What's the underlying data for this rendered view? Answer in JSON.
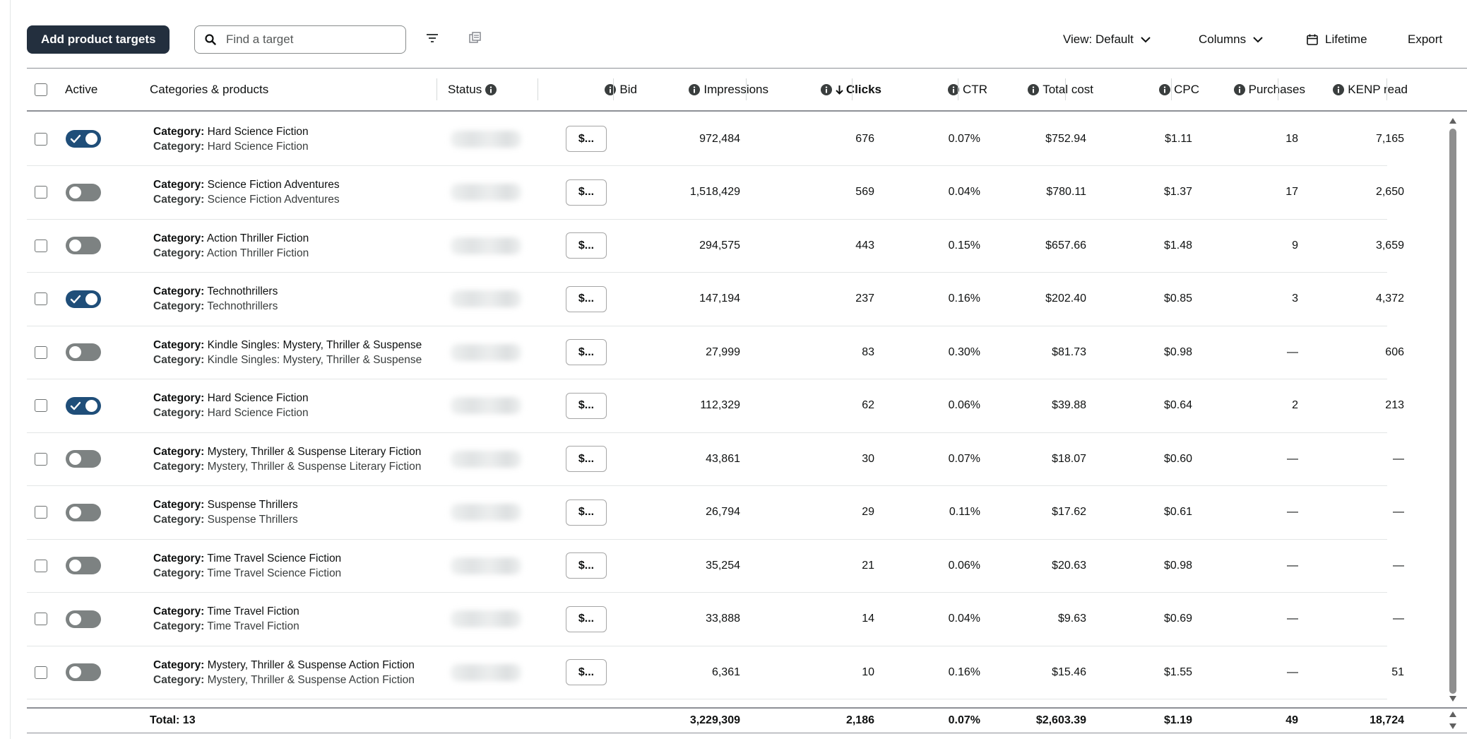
{
  "toolbar": {
    "add_button_label": "Add product targets",
    "search_placeholder": "Find a target",
    "view_label": "View: Default",
    "columns_label": "Columns",
    "date_range_label": "Lifetime",
    "export_label": "Export"
  },
  "table": {
    "headers": {
      "active": "Active",
      "categories": "Categories & products",
      "status": "Status",
      "bid": "Bid",
      "impressions": "Impressions",
      "clicks": "Clicks",
      "ctr": "CTR",
      "total_cost": "Total cost",
      "cpc": "CPC",
      "purchases": "Purchases",
      "kenp": "KENP read"
    },
    "sort_column": "clicks",
    "sort_direction": "descending",
    "category_prefix": "Category:",
    "rows": [
      {
        "active": true,
        "category": "Hard Science Fiction",
        "bid": "$...",
        "impressions": "972,484",
        "clicks": "676",
        "ctr": "0.07%",
        "total_cost": "$752.94",
        "cpc": "$1.11",
        "purchases": "18",
        "kenp": "7,165"
      },
      {
        "active": false,
        "category": "Science Fiction Adventures",
        "bid": "$...",
        "impressions": "1,518,429",
        "clicks": "569",
        "ctr": "0.04%",
        "total_cost": "$780.11",
        "cpc": "$1.37",
        "purchases": "17",
        "kenp": "2,650"
      },
      {
        "active": false,
        "category": "Action Thriller Fiction",
        "bid": "$...",
        "impressions": "294,575",
        "clicks": "443",
        "ctr": "0.15%",
        "total_cost": "$657.66",
        "cpc": "$1.48",
        "purchases": "9",
        "kenp": "3,659"
      },
      {
        "active": true,
        "category": "Technothrillers",
        "bid": "$...",
        "impressions": "147,194",
        "clicks": "237",
        "ctr": "0.16%",
        "total_cost": "$202.40",
        "cpc": "$0.85",
        "purchases": "3",
        "kenp": "4,372"
      },
      {
        "active": false,
        "category": "Kindle Singles: Mystery, Thriller & Suspense",
        "bid": "$...",
        "impressions": "27,999",
        "clicks": "83",
        "ctr": "0.30%",
        "total_cost": "$81.73",
        "cpc": "$0.98",
        "purchases": "—",
        "kenp": "606"
      },
      {
        "active": true,
        "category": "Hard Science Fiction",
        "bid": "$...",
        "impressions": "112,329",
        "clicks": "62",
        "ctr": "0.06%",
        "total_cost": "$39.88",
        "cpc": "$0.64",
        "purchases": "2",
        "kenp": "213"
      },
      {
        "active": false,
        "category": "Mystery, Thriller & Suspense Literary Fiction",
        "bid": "$...",
        "impressions": "43,861",
        "clicks": "30",
        "ctr": "0.07%",
        "total_cost": "$18.07",
        "cpc": "$0.60",
        "purchases": "—",
        "kenp": "—"
      },
      {
        "active": false,
        "category": "Suspense Thrillers",
        "bid": "$...",
        "impressions": "26,794",
        "clicks": "29",
        "ctr": "0.11%",
        "total_cost": "$17.62",
        "cpc": "$0.61",
        "purchases": "—",
        "kenp": "—"
      },
      {
        "active": false,
        "category": "Time Travel Science Fiction",
        "bid": "$...",
        "impressions": "35,254",
        "clicks": "21",
        "ctr": "0.06%",
        "total_cost": "$20.63",
        "cpc": "$0.98",
        "purchases": "—",
        "kenp": "—"
      },
      {
        "active": false,
        "category": "Time Travel Fiction",
        "bid": "$...",
        "impressions": "33,888",
        "clicks": "14",
        "ctr": "0.04%",
        "total_cost": "$9.63",
        "cpc": "$0.69",
        "purchases": "—",
        "kenp": "—"
      },
      {
        "active": false,
        "category": "Mystery, Thriller & Suspense Action Fiction",
        "bid": "$...",
        "impressions": "6,361",
        "clicks": "10",
        "ctr": "0.16%",
        "total_cost": "$15.46",
        "cpc": "$1.55",
        "purchases": "—",
        "kenp": "51"
      }
    ],
    "totals": {
      "label": "Total: 13",
      "impressions": "3,229,309",
      "clicks": "2,186",
      "ctr": "0.07%",
      "total_cost": "$2,603.39",
      "cpc": "$1.19",
      "purchases": "49",
      "kenp": "18,724"
    }
  },
  "colors": {
    "primary_button": "#232f3e",
    "toggle_on": "#1f4e79",
    "toggle_off": "#7d8282"
  },
  "icons": [
    "search-icon",
    "filter-icon",
    "bulk-edit-icon",
    "chevron-down-icon",
    "calendar-icon",
    "info-icon",
    "sort-down-arrow-icon",
    "checkmark-icon"
  ]
}
